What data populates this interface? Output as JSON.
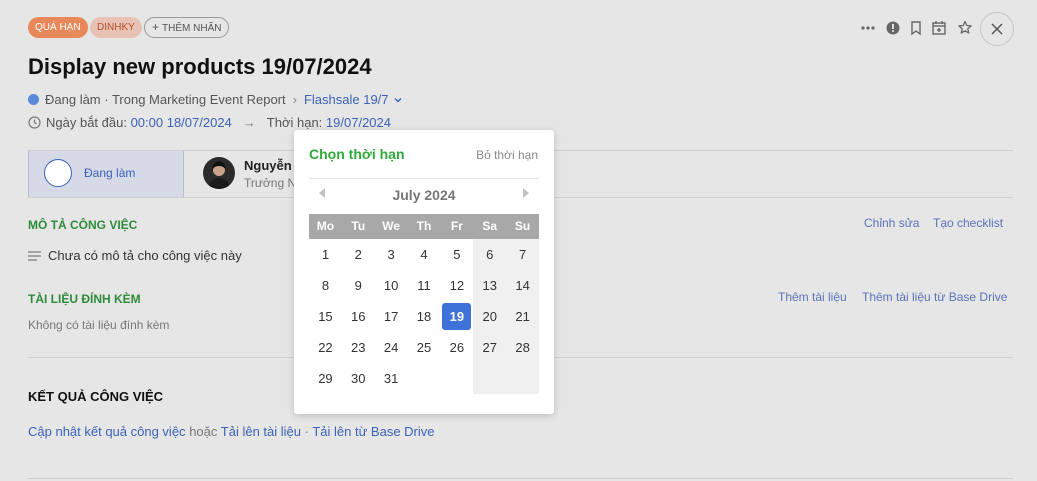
{
  "tags": {
    "overdue": "QUÁ HẠN",
    "dinhky": "DINHKY",
    "add": "THÊM NHÃN"
  },
  "toolbar_icons": [
    "more-icon",
    "alert-icon",
    "bookmark-icon",
    "calendar-add-icon",
    "star-icon",
    "close-icon"
  ],
  "task": {
    "title": "Display new products 19/07/2024",
    "status": "Đang làm",
    "context": "· Trong Marketing Event Report",
    "sep": "›",
    "sub": "Flashsale 19/7",
    "start_label": "Ngày bắt đầu:",
    "start_value": "00:00 18/07/2024",
    "arrow": "→",
    "deadline_label": "Thời hạn:",
    "deadline_value": "19/07/2024"
  },
  "status_box": {
    "label": "Đang làm"
  },
  "assignee": {
    "name": "Nguyễn C",
    "role": "Trưởng N"
  },
  "description": {
    "title": "MÔ TẢ CÔNG VIỆC",
    "edit": "Chỉnh sửa",
    "checklist": "Tạo checklist",
    "empty": "Chưa có mô tả cho công việc này"
  },
  "attachments": {
    "title": "TÀI LIỆU ĐÍNH KÈM",
    "add": "Thêm tài liệu",
    "add_drive": "Thêm tài liệu từ Base Drive",
    "empty": "Không có tài liệu đính kèm"
  },
  "results": {
    "title": "KẾT QUẢ CÔNG VIỆC",
    "update": "Cập nhật kết quả công việc",
    "or": "hoặc",
    "upload": "Tải lên tài liệu",
    "dot": "·",
    "upload_drive": "Tải lên từ Base Drive"
  },
  "datepicker": {
    "title": "Chọn thời hạn",
    "clear": "Bỏ thời hạn",
    "month": "July 2024",
    "weekdays": [
      "Mo",
      "Tu",
      "We",
      "Th",
      "Fr",
      "Sa",
      "Su"
    ],
    "weeks": [
      [
        "1",
        "2",
        "3",
        "4",
        "5",
        "6",
        "7"
      ],
      [
        "8",
        "9",
        "10",
        "11",
        "12",
        "13",
        "14"
      ],
      [
        "15",
        "16",
        "17",
        "18",
        "19",
        "20",
        "21"
      ],
      [
        "22",
        "23",
        "24",
        "25",
        "26",
        "27",
        "28"
      ],
      [
        "29",
        "30",
        "31",
        "",
        "",
        "",
        ""
      ]
    ],
    "selected": "19"
  },
  "colors": {
    "overdue_tag": "#e8885a",
    "link_blue": "#3a62b8",
    "section_green": "#2e8b3a",
    "popup_title_green": "#2eaa3c",
    "selected_day": "#3e72d8"
  }
}
